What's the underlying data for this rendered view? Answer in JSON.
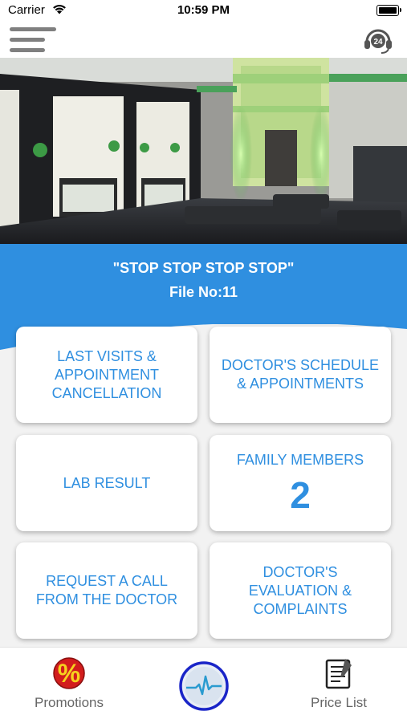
{
  "status_bar": {
    "carrier": "Carrier",
    "time": "10:59 PM"
  },
  "header": {
    "menu_icon": "hamburger-menu-icon",
    "support_icon": "24h-support-headset-icon",
    "support_badge": "24"
  },
  "hero": {
    "image": "hospital-lobby-photo"
  },
  "patient": {
    "name": "\"STOP STOP STOP STOP\"",
    "file_no": "File No:11"
  },
  "colors": {
    "accent": "#2f8fe0",
    "tab_label": "#666666"
  },
  "cards": {
    "last_visits": "LAST VISITS &\nAPPOINTMENT\nCANCELLATION",
    "doctor_schedule": "DOCTOR'S SCHEDULE\n& APPOINTMENTS",
    "lab_result": "LAB RESULT",
    "family_members": "FAMILY MEMBERS",
    "family_count": "2",
    "request_call": "REQUEST A CALL\nFROM THE DOCTOR",
    "doctor_evaluation": "DOCTOR'S\nEVALUATION &\nCOMPLAINTS"
  },
  "tabs": {
    "promotions": "Promotions",
    "price_list": "Price List",
    "promotions_icon": "percent-badge-icon",
    "center_icon": "heartbeat-icon",
    "price_list_icon": "clipboard-list-icon"
  }
}
